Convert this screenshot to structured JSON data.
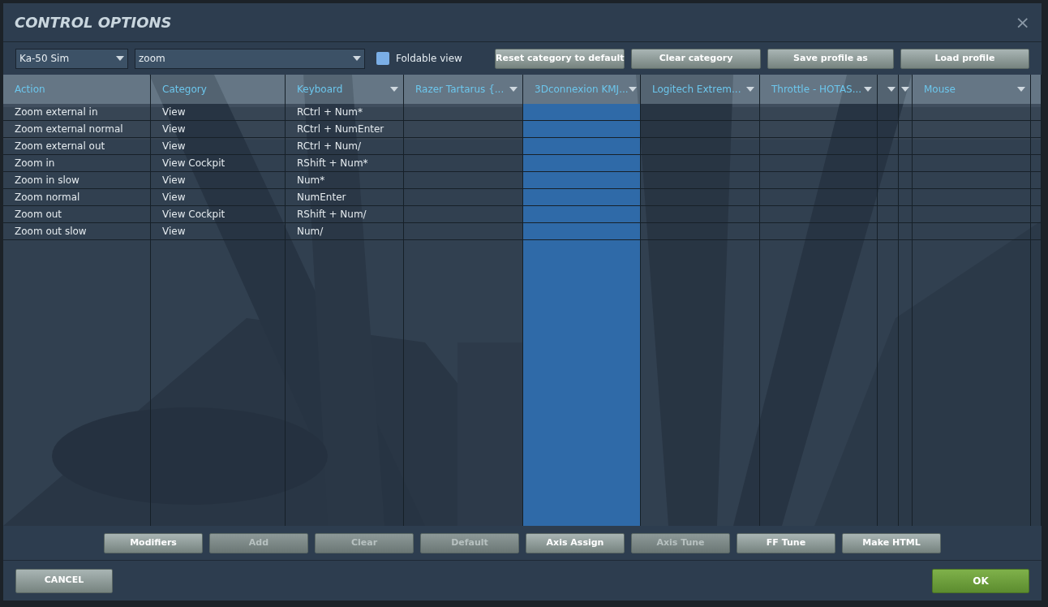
{
  "window": {
    "title": "CONTROL OPTIONS",
    "close": "×"
  },
  "toolbar": {
    "aircraft": {
      "value": "Ka-50 Sim"
    },
    "category_filter": {
      "value": "zoom"
    },
    "foldable_view": {
      "label": "Foldable view",
      "checked": false
    },
    "buttons": [
      {
        "label": "Reset category to default",
        "disabled": false
      },
      {
        "label": "Clear category",
        "disabled": false
      },
      {
        "label": "Save profile as",
        "disabled": false
      },
      {
        "label": "Load profile",
        "disabled": false
      }
    ]
  },
  "table": {
    "columns": [
      {
        "label": "Action",
        "dropdown": false,
        "selected": false
      },
      {
        "label": "Category",
        "dropdown": false,
        "selected": false
      },
      {
        "label": "Keyboard",
        "dropdown": true,
        "selected": false
      },
      {
        "label": "Razer Tartarus {...",
        "dropdown": true,
        "selected": false
      },
      {
        "label": "3Dconnexion KMJ...",
        "dropdown": true,
        "selected": true
      },
      {
        "label": "Logitech Extrem...",
        "dropdown": true,
        "selected": false
      },
      {
        "label": "Throttle - HOTAS...",
        "dropdown": true,
        "selected": false
      },
      {
        "dropdown": true,
        "selected": false
      },
      {
        "dropdown": true,
        "selected": false
      },
      {
        "label": "Mouse",
        "dropdown": true,
        "selected": false
      },
      {
        "dropdown": false,
        "selected": false
      }
    ],
    "rows": [
      [
        "Zoom external in",
        "View",
        "RCtrl + Num*"
      ],
      [
        "Zoom external normal",
        "View",
        "RCtrl + NumEnter"
      ],
      [
        "Zoom external out",
        "View",
        "RCtrl + Num/"
      ],
      [
        "Zoom in",
        "View Cockpit",
        "RShift + Num*"
      ],
      [
        "Zoom in slow",
        "View",
        "Num*"
      ],
      [
        "Zoom normal",
        "View",
        "NumEnter"
      ],
      [
        "Zoom out",
        "View Cockpit",
        "RShift + Num/"
      ],
      [
        "Zoom out slow",
        "View",
        "Num/"
      ]
    ]
  },
  "actions": [
    {
      "label": "Modifiers",
      "disabled": false
    },
    {
      "label": "Add",
      "disabled": true
    },
    {
      "label": "Clear",
      "disabled": true
    },
    {
      "label": "Default",
      "disabled": true
    },
    {
      "label": "Axis Assign",
      "disabled": false
    },
    {
      "label": "Axis Tune",
      "disabled": true
    },
    {
      "label": "FF Tune",
      "disabled": false
    },
    {
      "label": "Make HTML",
      "disabled": false
    }
  ],
  "footer": {
    "cancel": "CANCEL",
    "ok": "OK"
  }
}
